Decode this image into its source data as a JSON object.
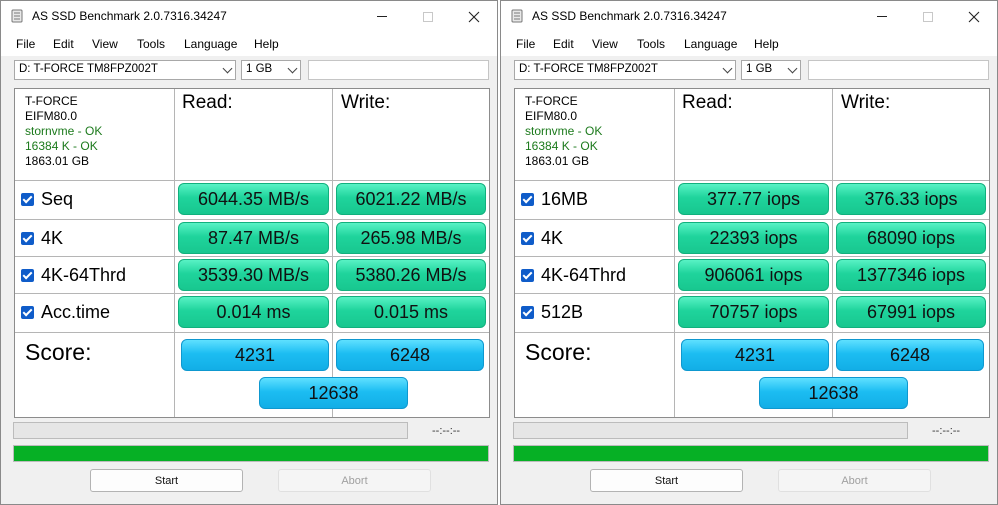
{
  "windows": [
    {
      "title": "AS SSD Benchmark 2.0.7316.34247",
      "menu": [
        "File",
        "Edit",
        "View",
        "Tools",
        "Language",
        "Help"
      ],
      "drive_select": "D: T-FORCE TM8FPZ002T",
      "size_select": "1 GB",
      "info": {
        "model": "T-FORCE",
        "firmware": "EIFM80.0",
        "driver_status": "stornvme - OK",
        "alignment_status": "16384 K - OK",
        "capacity": "1863.01 GB"
      },
      "headers": {
        "read": "Read:",
        "write": "Write:"
      },
      "rows": [
        {
          "label": "Seq",
          "read": "6044.35 MB/s",
          "write": "6021.22 MB/s"
        },
        {
          "label": "4K",
          "read": "87.47 MB/s",
          "write": "265.98 MB/s"
        },
        {
          "label": "4K-64Thrd",
          "read": "3539.30 MB/s",
          "write": "5380.26 MB/s"
        },
        {
          "label": "Acc.time",
          "read": "0.014 ms",
          "write": "0.015 ms"
        }
      ],
      "score": {
        "label": "Score:",
        "read": "4231",
        "write": "6248",
        "total": "12638"
      },
      "time": "--:--:--",
      "buttons": {
        "start": "Start",
        "abort": "Abort"
      }
    },
    {
      "title": "AS SSD Benchmark 2.0.7316.34247",
      "menu": [
        "File",
        "Edit",
        "View",
        "Tools",
        "Language",
        "Help"
      ],
      "drive_select": "D: T-FORCE TM8FPZ002T",
      "size_select": "1 GB",
      "info": {
        "model": "T-FORCE",
        "firmware": "EIFM80.0",
        "driver_status": "stornvme - OK",
        "alignment_status": "16384 K - OK",
        "capacity": "1863.01 GB"
      },
      "headers": {
        "read": "Read:",
        "write": "Write:"
      },
      "rows": [
        {
          "label": "16MB",
          "read": "377.77 iops",
          "write": "376.33 iops"
        },
        {
          "label": "4K",
          "read": "22393 iops",
          "write": "68090 iops"
        },
        {
          "label": "4K-64Thrd",
          "read": "906061 iops",
          "write": "1377346 iops"
        },
        {
          "label": "512B",
          "read": "70757 iops",
          "write": "67991 iops"
        }
      ],
      "score": {
        "label": "Score:",
        "read": "4231",
        "write": "6248",
        "total": "12638"
      },
      "time": "--:--:--",
      "buttons": {
        "start": "Start",
        "abort": "Abort"
      }
    }
  ],
  "colors": {
    "result_green": "#1fd49c",
    "score_blue": "#1cbdf2",
    "progress_green": "#06b025",
    "status_ok_green": "#1c7a1c",
    "checkbox_blue": "#0f5cc9"
  },
  "progress": {
    "main_fill": 1.0,
    "small_fill": 0.0
  }
}
